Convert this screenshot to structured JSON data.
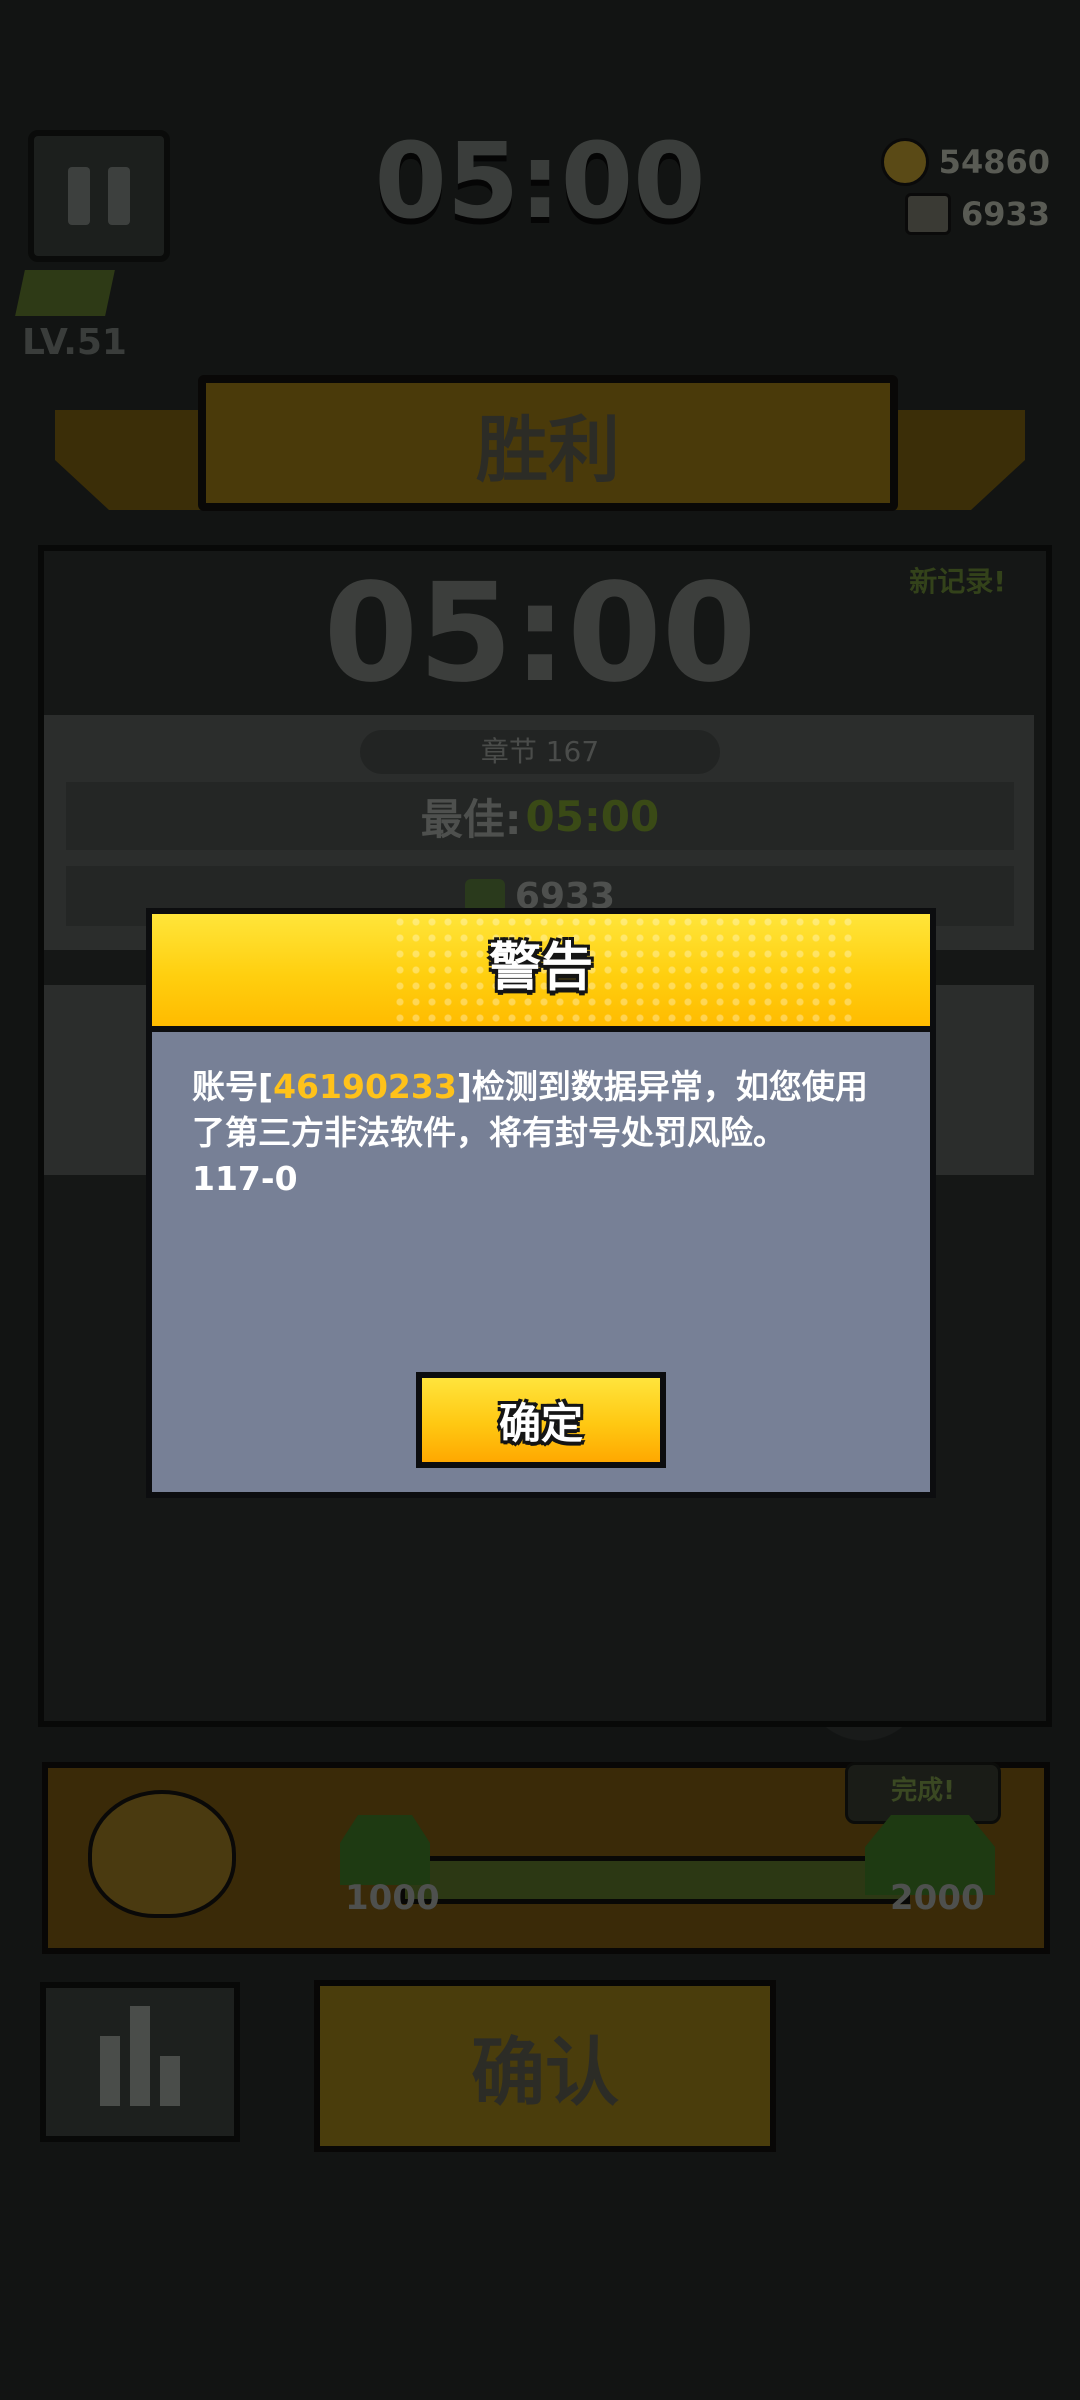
{
  "hud": {
    "timer": "05:00",
    "coins": "54860",
    "gems": "6933",
    "level": "LV.51"
  },
  "banner": {
    "title": "胜利"
  },
  "result": {
    "new_record": "新记录!",
    "time": "05:00",
    "chapter": "章节 167",
    "best_label": "最佳:",
    "best_value": "05:00",
    "score": "6933"
  },
  "reward": {
    "done_label": "完成!",
    "progress_min": "1000",
    "progress_max": "2000",
    "progress_fraction": 1.0
  },
  "footer": {
    "confirm_label": "确认"
  },
  "dialog": {
    "title": "警告",
    "msg_prefix": "账号[",
    "account_id": "46190233",
    "msg_suffix": "]检测到数据异常，如您使用了第三方非法软件，将有封号处罚风险。",
    "code": "117-0",
    "ok_label": "确定"
  },
  "colors": {
    "dialog_header": "#ffcf0f",
    "dialog_body": "#778096",
    "account_highlight": "#ffc21a"
  }
}
